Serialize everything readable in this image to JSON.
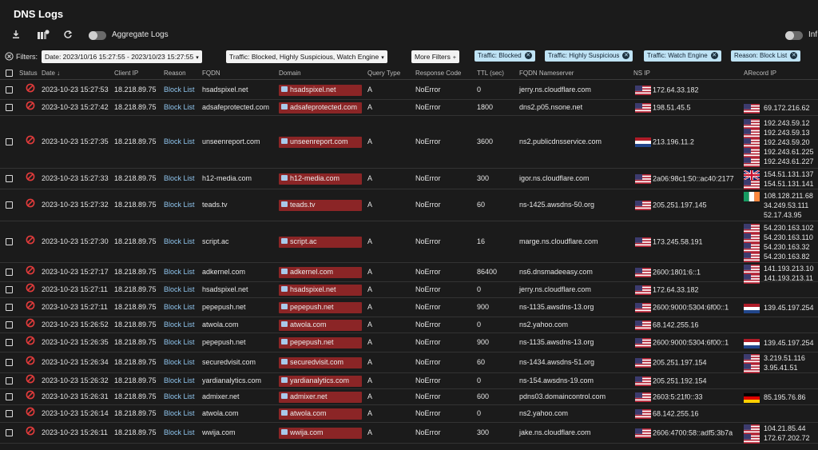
{
  "app": {
    "title": "DNS Logs"
  },
  "toolbar": {
    "aggregate_label": "Aggregate Logs",
    "right_toggle_label": "Inf"
  },
  "filters": {
    "label": "Filters:",
    "date": "Date: 2023/10/16 15:27:55 - 2023/10/23 15:27:55",
    "traffic": "Traffic: Blocked, Highly Suspicious, Watch Engine",
    "more": "More Filters",
    "chips": [
      "Traffic: Blocked",
      "Traffic: Highly Suspicious",
      "Traffic: Watch Engine",
      "Reason: Block List"
    ]
  },
  "columns": {
    "status": "Status",
    "date": "Date",
    "client_ip": "Client IP",
    "reason": "Reason",
    "fqdn": "FQDN",
    "domain": "Domain",
    "query_type": "Query Type",
    "response_code": "Response Code",
    "ttl": "TTL (sec)",
    "fqdn_ns": "FQDN Nameserver",
    "ns_ip": "NS IP",
    "arecord": "ARecord IP"
  },
  "colors": {
    "domain_tag": "#8b2526",
    "reason_link": "#8fc5ee",
    "chip": "#bfe3f5",
    "status_blocked": "#e23b3b"
  },
  "rows": [
    {
      "date": "2023-10-23 15:27:53",
      "client": "18.218.89.75",
      "reason": "Block List",
      "fqdn": "hsadspixel.net",
      "domain": "hsadspixel.net",
      "qtype": "A",
      "rcode": "NoError",
      "ttl": "0",
      "ns": "jerry.ns.cloudflare.com",
      "ns_flag": "us",
      "ns_ip": "172.64.33.182",
      "a_flags": [],
      "a_ips": []
    },
    {
      "date": "2023-10-23 15:27:42",
      "client": "18.218.89.75",
      "reason": "Block List",
      "fqdn": "adsafeprotected.com",
      "domain": "adsafeprotected.com",
      "qtype": "A",
      "rcode": "NoError",
      "ttl": "1800",
      "ns": "dns2.p05.nsone.net",
      "ns_flag": "us",
      "ns_ip": "198.51.45.5",
      "a_flags": [
        "us"
      ],
      "a_ips": [
        "69.172.216.62"
      ]
    },
    {
      "date": "2023-10-23 15:27:35",
      "client": "18.218.89.75",
      "reason": "Block List",
      "fqdn": "unseenreport.com",
      "domain": "unseenreport.com",
      "qtype": "A",
      "rcode": "NoError",
      "ttl": "3600",
      "ns": "ns2.publicdnsservice.com",
      "ns_flag": "nl",
      "ns_ip": "213.196.11.2",
      "a_flags": [
        "us",
        "us",
        "us",
        "us",
        "us"
      ],
      "a_ips": [
        "192.243.59.12",
        "192.243.59.13",
        "192.243.59.20",
        "192.243.61.225",
        "192.243.61.227"
      ]
    },
    {
      "date": "2023-10-23 15:27:33",
      "client": "18.218.89.75",
      "reason": "Block List",
      "fqdn": "h12-media.com",
      "domain": "h12-media.com",
      "qtype": "A",
      "rcode": "NoError",
      "ttl": "300",
      "ns": "igor.ns.cloudflare.com",
      "ns_flag": "us",
      "ns_ip": "2a06:98c1:50::ac40:2177",
      "a_flags": [
        "gb",
        "us"
      ],
      "a_ips": [
        "154.51.131.137",
        "154.51.131.141"
      ]
    },
    {
      "date": "2023-10-23 15:27:32",
      "client": "18.218.89.75",
      "reason": "Block List",
      "fqdn": "teads.tv",
      "domain": "teads.tv",
      "qtype": "A",
      "rcode": "NoError",
      "ttl": "60",
      "ns": "ns-1425.awsdns-50.org",
      "ns_flag": "us",
      "ns_ip": "205.251.197.145",
      "a_flags": [
        "ie"
      ],
      "a_ips": [
        "108.128.211.68",
        "34.249.53.111",
        "52.17.43.95"
      ]
    },
    {
      "date": "2023-10-23 15:27:30",
      "client": "18.218.89.75",
      "reason": "Block List",
      "fqdn": "script.ac",
      "domain": "script.ac",
      "qtype": "A",
      "rcode": "NoError",
      "ttl": "16",
      "ns": "marge.ns.cloudflare.com",
      "ns_flag": "us",
      "ns_ip": "173.245.58.191",
      "a_flags": [
        "us",
        "us",
        "us",
        "us"
      ],
      "a_ips": [
        "54.230.163.102",
        "54.230.163.110",
        "54.230.163.32",
        "54.230.163.82"
      ]
    },
    {
      "date": "2023-10-23 15:27:17",
      "client": "18.218.89.75",
      "reason": "Block List",
      "fqdn": "adkernel.com",
      "domain": "adkernel.com",
      "qtype": "A",
      "rcode": "NoError",
      "ttl": "86400",
      "ns": "ns6.dnsmadeeasy.com",
      "ns_flag": "us",
      "ns_ip": "2600:1801:6::1",
      "a_flags": [
        "us",
        "us"
      ],
      "a_ips": [
        "141.193.213.10",
        "141.193.213.11"
      ]
    },
    {
      "date": "2023-10-23 15:27:11",
      "client": "18.218.89.75",
      "reason": "Block List",
      "fqdn": "hsadspixel.net",
      "domain": "hsadspixel.net",
      "qtype": "A",
      "rcode": "NoError",
      "ttl": "0",
      "ns": "jerry.ns.cloudflare.com",
      "ns_flag": "us",
      "ns_ip": "172.64.33.182",
      "a_flags": [],
      "a_ips": []
    },
    {
      "date": "2023-10-23 15:27:11",
      "client": "18.218.89.75",
      "reason": "Block List",
      "fqdn": "pepepush.net",
      "domain": "pepepush.net",
      "qtype": "A",
      "rcode": "NoError",
      "ttl": "900",
      "ns": "ns-1135.awsdns-13.org",
      "ns_flag": "us",
      "ns_ip": "2600:9000:5304:6f00::1",
      "a_flags": [
        "nl"
      ],
      "a_ips": [
        "139.45.197.254"
      ]
    },
    {
      "date": "2023-10-23 15:26:52",
      "client": "18.218.89.75",
      "reason": "Block List",
      "fqdn": "atwola.com",
      "domain": "atwola.com",
      "qtype": "A",
      "rcode": "NoError",
      "ttl": "0",
      "ns": "ns2.yahoo.com",
      "ns_flag": "us",
      "ns_ip": "68.142.255.16",
      "a_flags": [],
      "a_ips": []
    },
    {
      "date": "2023-10-23 15:26:35",
      "client": "18.218.89.75",
      "reason": "Block List",
      "fqdn": "pepepush.net",
      "domain": "pepepush.net",
      "qtype": "A",
      "rcode": "NoError",
      "ttl": "900",
      "ns": "ns-1135.awsdns-13.org",
      "ns_flag": "us",
      "ns_ip": "2600:9000:5304:6f00::1",
      "a_flags": [
        "nl"
      ],
      "a_ips": [
        "139.45.197.254"
      ]
    },
    {
      "date": "2023-10-23 15:26:34",
      "client": "18.218.89.75",
      "reason": "Block List",
      "fqdn": "securedvisit.com",
      "domain": "securedvisit.com",
      "qtype": "A",
      "rcode": "NoError",
      "ttl": "60",
      "ns": "ns-1434.awsdns-51.org",
      "ns_flag": "us",
      "ns_ip": "205.251.197.154",
      "a_flags": [
        "us",
        "us"
      ],
      "a_ips": [
        "3.219.51.116",
        "3.95.41.51"
      ]
    },
    {
      "date": "2023-10-23 15:26:32",
      "client": "18.218.89.75",
      "reason": "Block List",
      "fqdn": "yardianalytics.com",
      "domain": "yardianalytics.com",
      "qtype": "A",
      "rcode": "NoError",
      "ttl": "0",
      "ns": "ns-154.awsdns-19.com",
      "ns_flag": "us",
      "ns_ip": "205.251.192.154",
      "a_flags": [],
      "a_ips": []
    },
    {
      "date": "2023-10-23 15:26:31",
      "client": "18.218.89.75",
      "reason": "Block List",
      "fqdn": "admixer.net",
      "domain": "admixer.net",
      "qtype": "A",
      "rcode": "NoError",
      "ttl": "600",
      "ns": "pdns03.domaincontrol.com",
      "ns_flag": "us",
      "ns_ip": "2603:5:21f0::33",
      "a_flags": [
        "de"
      ],
      "a_ips": [
        "85.195.76.86"
      ]
    },
    {
      "date": "2023-10-23 15:26:14",
      "client": "18.218.89.75",
      "reason": "Block List",
      "fqdn": "atwola.com",
      "domain": "atwola.com",
      "qtype": "A",
      "rcode": "NoError",
      "ttl": "0",
      "ns": "ns2.yahoo.com",
      "ns_flag": "us",
      "ns_ip": "68.142.255.16",
      "a_flags": [],
      "a_ips": []
    },
    {
      "date": "2023-10-23 15:26:11",
      "client": "18.218.89.75",
      "reason": "Block List",
      "fqdn": "wwija.com",
      "domain": "wwija.com",
      "qtype": "A",
      "rcode": "NoError",
      "ttl": "300",
      "ns": "jake.ns.cloudflare.com",
      "ns_flag": "us",
      "ns_ip": "2606:4700:58::adf5:3b7a",
      "a_flags": [
        "us",
        "us"
      ],
      "a_ips": [
        "104.21.85.44",
        "172.67.202.72"
      ]
    }
  ]
}
